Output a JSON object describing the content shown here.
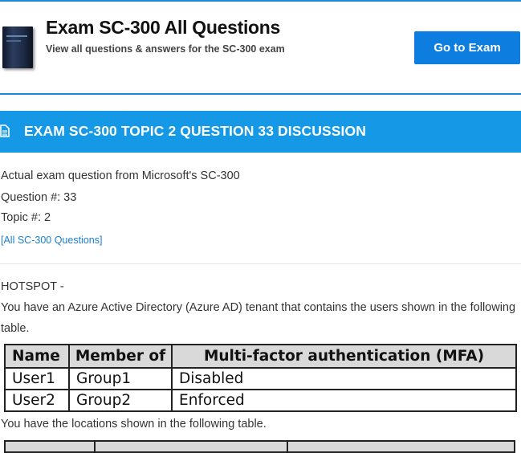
{
  "header": {
    "title": "Exam SC-300 All Questions",
    "subtitle": "View all questions & answers for the SC-300 exam",
    "go_button": "Go to Exam",
    "book_icon": "exam-book-cover"
  },
  "banner": {
    "icon": "document-icon",
    "title": "EXAM SC-300 TOPIC 2 QUESTION 33 DISCUSSION"
  },
  "meta": {
    "source": "Actual exam question from Microsoft's SC-300",
    "question": "Question #: 33",
    "topic": "Topic #: 2",
    "all_link": "[All SC-300 Questions]"
  },
  "question": {
    "type": "HOTSPOT -",
    "intro": "You have an Azure Active Directory (Azure AD) tenant that contains the users shown in the following",
    "intro2": "table.",
    "users_table": {
      "headers": [
        "Name",
        "Member of",
        "Multi-factor authentication (MFA)"
      ],
      "rows": [
        [
          "User1",
          "Group1",
          "Disabled"
        ],
        [
          "User2",
          "Group2",
          "Enforced"
        ]
      ]
    },
    "locations_intro": "You have the locations shown in the following table."
  },
  "colors": {
    "accent": "#1599e6",
    "button": "#0d7ddf",
    "link": "#1a7fd0"
  }
}
